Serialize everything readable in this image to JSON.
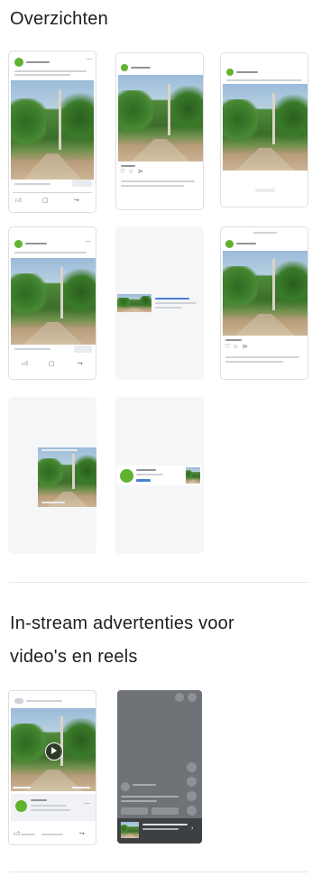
{
  "sections": {
    "overviews_title": "Overzichten",
    "instream_title_line1": "In-stream advertenties voor",
    "instream_title_line2": "video's en reels"
  },
  "overview_cards": [
    {
      "id": "feed-selected",
      "selected": true
    },
    {
      "id": "feed-2"
    },
    {
      "id": "feed-3"
    },
    {
      "id": "feed-4"
    },
    {
      "id": "right-column"
    },
    {
      "id": "feed-6"
    },
    {
      "id": "stories"
    },
    {
      "id": "search-results"
    }
  ],
  "instream_cards": [
    {
      "id": "instream-video"
    },
    {
      "id": "reels-overlay"
    }
  ],
  "colors": {
    "selection_border": "#4a90d9",
    "avatar_green": "#62b232",
    "card_bg": "#f5f6f7",
    "reel_bg": "#6f7276"
  },
  "icons": [
    "thumbs-up-icon",
    "comment-icon",
    "share-icon",
    "play-icon",
    "more-icon"
  ]
}
